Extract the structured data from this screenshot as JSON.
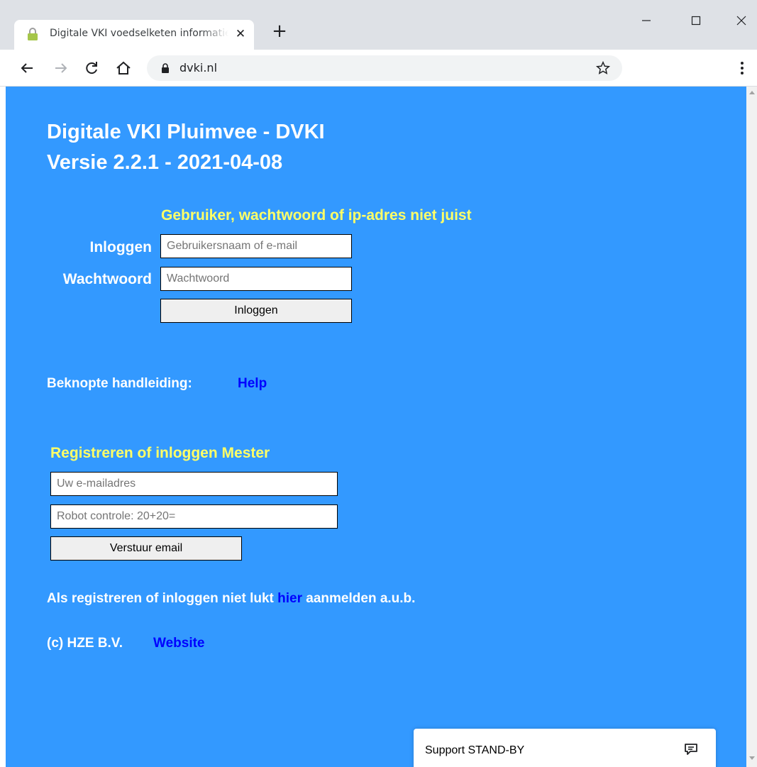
{
  "browser": {
    "tab_title": "Digitale VKI voedselketen informatie",
    "tab_close": "✕",
    "new_tab": "+",
    "url": "dvki.nl"
  },
  "page": {
    "title_line1": "Digitale VKI Pluimvee - DVKI",
    "title_line2": "Versie 2.2.1 - 2021-04-08",
    "error_message": "Gebruiker, wachtwoord of ip-adres niet juist",
    "login": {
      "username_label": "Inloggen",
      "username_placeholder": "Gebruikersnaam of e-mail",
      "password_label": "Wachtwoord",
      "password_placeholder": "Wachtwoord",
      "submit_label": "Inloggen"
    },
    "help": {
      "label": "Beknopte handleiding:",
      "link": "Help"
    },
    "mester": {
      "heading": "Registreren of inloggen Mester",
      "email_placeholder": "Uw e-mailadres",
      "robot_placeholder": "Robot controle: 20+20=",
      "submit_label": "Verstuur email"
    },
    "register_note": {
      "before": "Als registreren of inloggen niet lukt ",
      "link": "hier",
      "after": " aanmelden a.u.b."
    },
    "footer": {
      "copyright": "(c) HZE B.V.",
      "link": "Website"
    },
    "support_widget": {
      "label": "Support STAND-BY",
      "icon": "chat-icon"
    }
  },
  "colors": {
    "page_background": "#3399ff",
    "heading_white": "#ffffff",
    "accent_yellow": "#ffff66",
    "link_blue": "#0000ff"
  }
}
